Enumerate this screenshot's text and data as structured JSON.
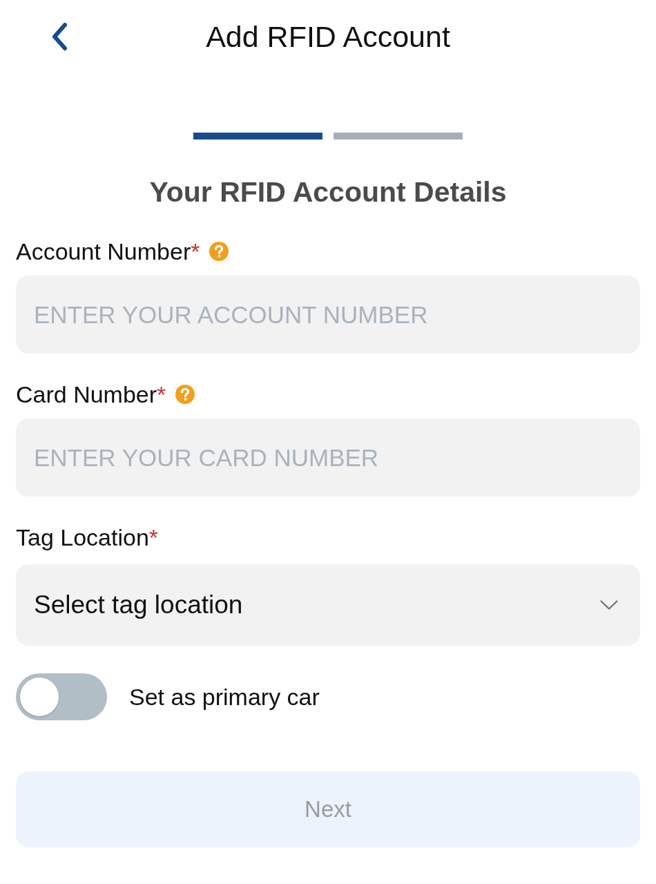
{
  "header": {
    "title": "Add RFID Account"
  },
  "progress_steps": [
    {
      "active": true
    },
    {
      "active": false
    }
  ],
  "form": {
    "heading": "Your RFID Account Details",
    "fields": [
      {
        "kind": "text",
        "label": "Account Number",
        "required_mark": "*",
        "help": true,
        "placeholder": "ENTER YOUR ACCOUNT NUMBER"
      },
      {
        "kind": "text",
        "label": "Card Number",
        "required_mark": "*",
        "help": true,
        "placeholder": "ENTER YOUR CARD NUMBER"
      },
      {
        "kind": "select",
        "label": "Tag Location",
        "required_mark": "*",
        "help": false,
        "placeholder": "Select tag location"
      }
    ]
  },
  "toggle": {
    "label": "Set as primary car",
    "on": false
  },
  "next_button": {
    "label": "Next",
    "disabled": true
  }
}
